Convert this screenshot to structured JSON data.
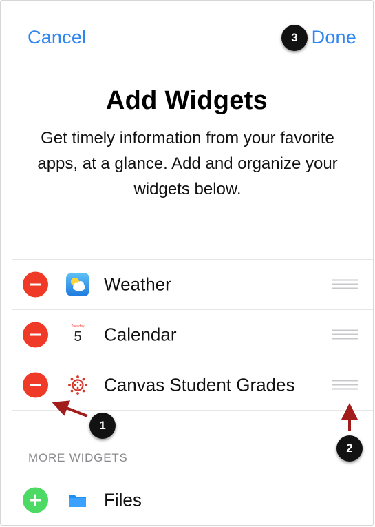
{
  "nav": {
    "cancel_label": "Cancel",
    "done_label": "Done"
  },
  "header": {
    "title": "Add Widgets",
    "description": "Get timely information from your favorite apps, at a glance. Add and organize your widgets below."
  },
  "active_widgets": [
    {
      "label": "Weather",
      "icon": "weather-icon"
    },
    {
      "label": "Calendar",
      "icon": "calendar-icon",
      "icon_day_name": "Tuesday",
      "icon_day_number": "5"
    },
    {
      "label": "Canvas Student Grades",
      "icon": "canvas-icon"
    }
  ],
  "more_widgets": {
    "header": "MORE WIDGETS",
    "items": [
      {
        "label": "Files",
        "icon": "files-folder-icon"
      }
    ]
  },
  "callouts": [
    "1",
    "2",
    "3"
  ],
  "colors": {
    "accent_blue": "#2f86f0",
    "remove_red": "#f03a28",
    "add_green": "#4cd964",
    "callout_bg": "#121212",
    "arrow_red": "#a31c1c"
  }
}
